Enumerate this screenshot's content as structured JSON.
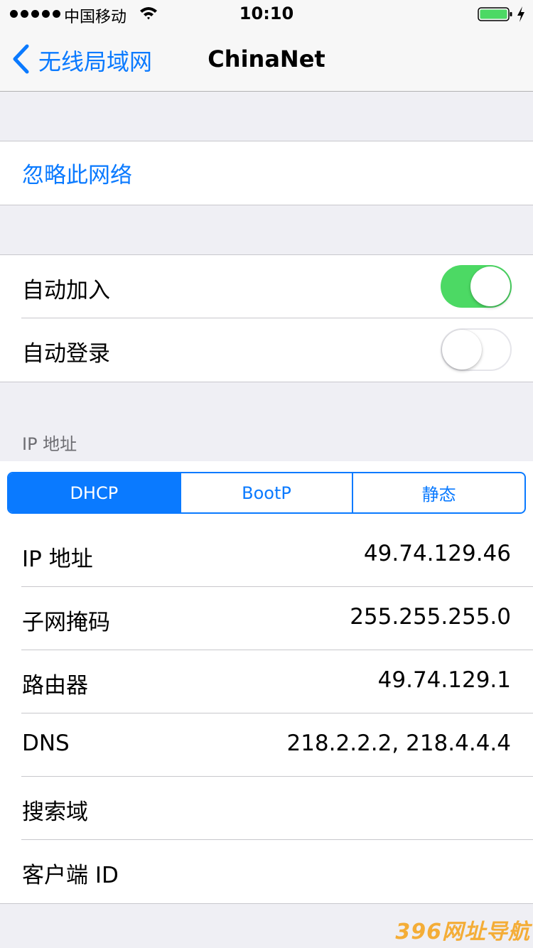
{
  "status_bar": {
    "carrier": "中国移动",
    "time": "10:10",
    "battery_color": "#4cd964"
  },
  "nav": {
    "back_label": "无线局域网",
    "title": "ChinaNet"
  },
  "forget": {
    "label": "忽略此网络"
  },
  "auto": {
    "join_label": "自动加入",
    "join_on": true,
    "login_label": "自动登录",
    "login_on": false
  },
  "ip_section": {
    "header": "IP 地址"
  },
  "segments": [
    {
      "label": "DHCP",
      "selected": true
    },
    {
      "label": "BootP",
      "selected": false
    },
    {
      "label": "静态",
      "selected": false
    }
  ],
  "details": [
    {
      "label": "IP 地址",
      "value": "49.74.129.46"
    },
    {
      "label": "子网掩码",
      "value": "255.255.255.0"
    },
    {
      "label": "路由器",
      "value": "49.74.129.1"
    },
    {
      "label": "DNS",
      "value": "218.2.2.2, 218.4.4.4"
    },
    {
      "label": "搜索域",
      "value": ""
    },
    {
      "label": "客户端 ID",
      "value": ""
    }
  ],
  "watermark": "396网址导航",
  "accent_color": "#0a7aff"
}
